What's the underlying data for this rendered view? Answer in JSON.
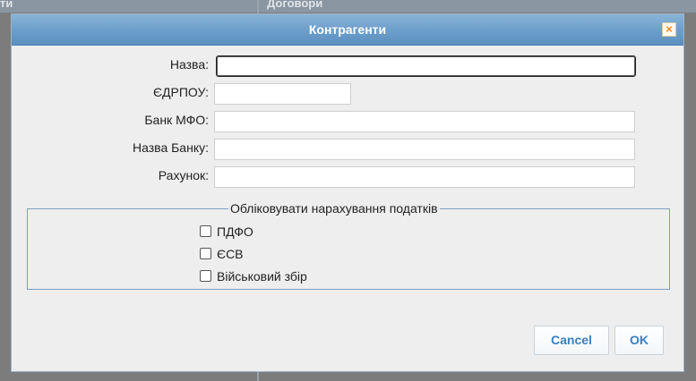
{
  "background": {
    "tab_left": "ти",
    "tab_right": "Договори"
  },
  "dialog": {
    "title": "Контрагенти",
    "close_glyph": "×",
    "fields": [
      {
        "label": "Назва:",
        "value": "",
        "placeholder": ""
      },
      {
        "label": "ЄДРПОУ:",
        "value": "",
        "placeholder": ""
      },
      {
        "label": "Банк МФО:",
        "value": "",
        "placeholder": ""
      },
      {
        "label": "Назва Банку:",
        "value": "",
        "placeholder": ""
      },
      {
        "label": "Рахунок:",
        "value": "",
        "placeholder": ""
      }
    ],
    "taxes_group": {
      "legend": "Обліковувати нарахування податків",
      "options": [
        {
          "label": "ПДФО",
          "checked": false
        },
        {
          "label": "ЄСВ",
          "checked": false
        },
        {
          "label": "Військовий збір",
          "checked": false
        }
      ]
    },
    "buttons": {
      "cancel": "Cancel",
      "ok": "OK"
    }
  },
  "colors": {
    "accent": "#3a7fbf",
    "titlebar": "#6e9fcb",
    "close_icon": "#e8891f"
  }
}
